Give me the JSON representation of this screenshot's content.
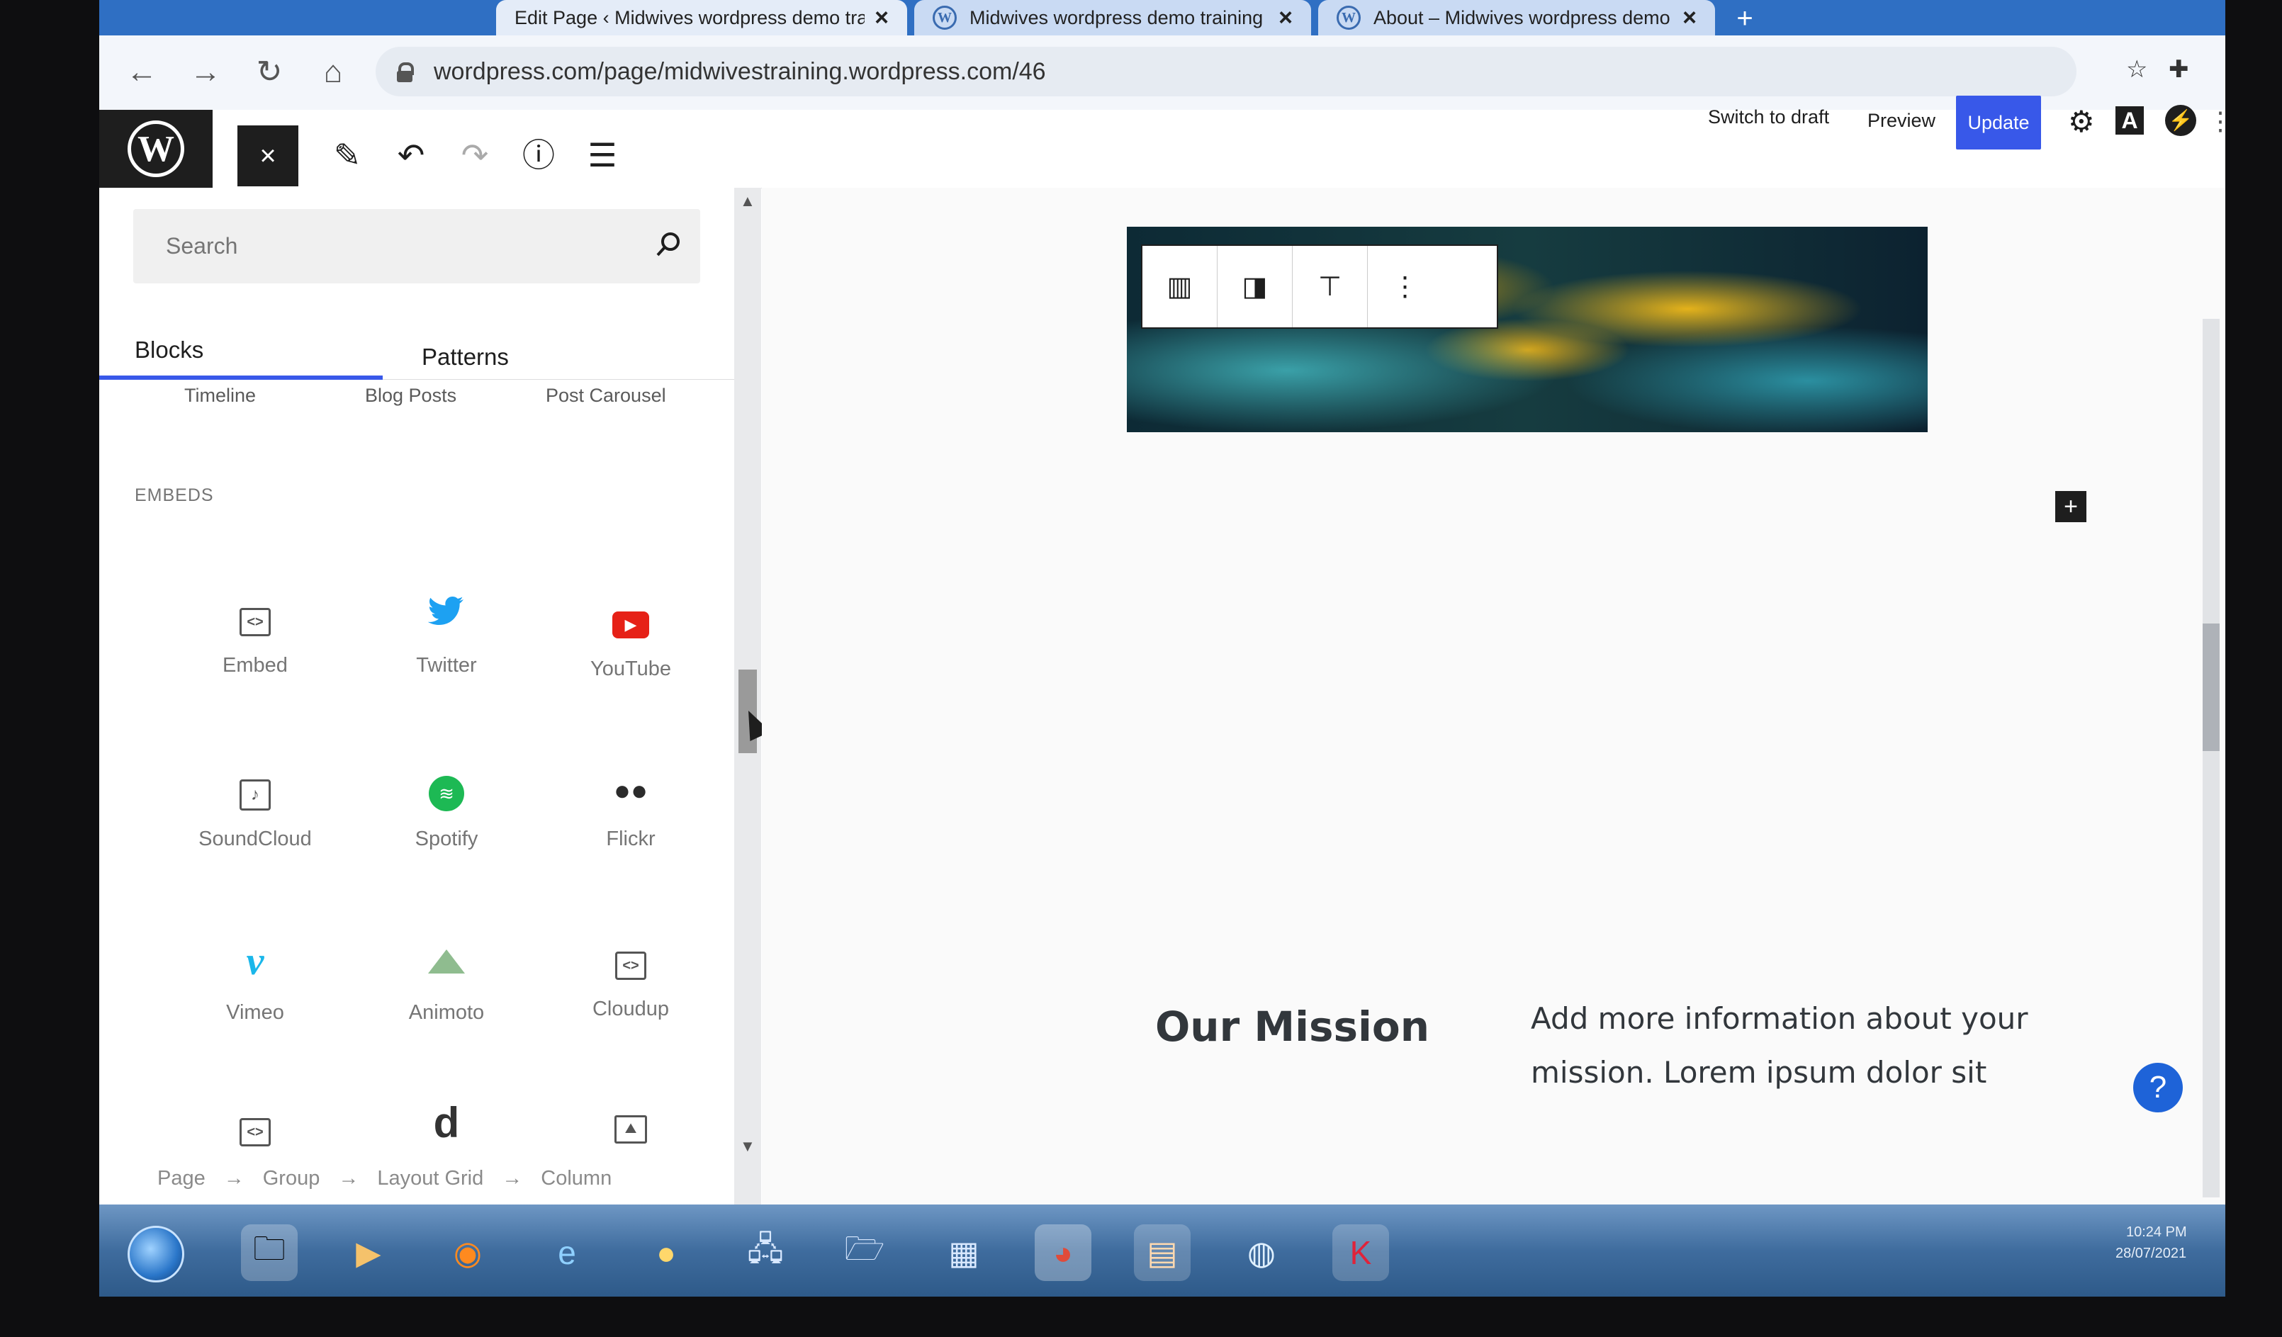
{
  "browser": {
    "tabs": [
      {
        "label": "Edit Page ‹ Midwives wordpress demo training — WordPress.com"
      },
      {
        "label": "Midwives wordpress demo training"
      },
      {
        "label": "About – Midwives wordpress demo training"
      }
    ],
    "url": "wordpress.com/page/midwivestraining.wordpress.com/46",
    "new_tab_label": "+"
  },
  "editor_header": {
    "switch_to_draft": "Switch to draft",
    "preview": "Preview",
    "update": "Update",
    "styles_letter": "A"
  },
  "inserter": {
    "search_placeholder": "Search",
    "tabs": {
      "blocks": "Blocks",
      "patterns": "Patterns"
    },
    "cut_off_items": [
      "Timeline",
      "Blog Posts",
      "Post Carousel"
    ],
    "embeds_heading": "EMBEDS",
    "embed_blocks": [
      {
        "label": "Embed",
        "icon": "embed-icon"
      },
      {
        "label": "Twitter",
        "icon": "twitter-icon"
      },
      {
        "label": "YouTube",
        "icon": "youtube-icon"
      },
      {
        "label": "SoundCloud",
        "icon": "soundcloud-icon"
      },
      {
        "label": "Spotify",
        "icon": "spotify-icon"
      },
      {
        "label": "Flickr",
        "icon": "flickr-icon"
      },
      {
        "label": "Vimeo",
        "icon": "vimeo-icon"
      },
      {
        "label": "Animoto",
        "icon": "animoto-icon"
      },
      {
        "label": "Cloudup",
        "icon": "cloudup-icon"
      }
    ],
    "partial_row_icons": [
      "embed-icon",
      "layout-grid-icon",
      "image-icon"
    ],
    "breadcrumb": [
      "Page",
      "→",
      "Group",
      "→",
      "Layout Grid",
      "→",
      "Column"
    ]
  },
  "canvas": {
    "mission_heading": "Our Mission",
    "mission_text": "Add more information about your mission. Lorem ipsum dolor sit amet, consectetur adipiscing elit. In sit amet"
  },
  "help_button": "?",
  "taskbar": {
    "clock_time": "10:24 PM",
    "clock_date": "28/07/2021"
  },
  "colors": {
    "accent": "#3858e9",
    "dark": "#1e1e1e",
    "tab_bar": "#2f6fc3"
  }
}
